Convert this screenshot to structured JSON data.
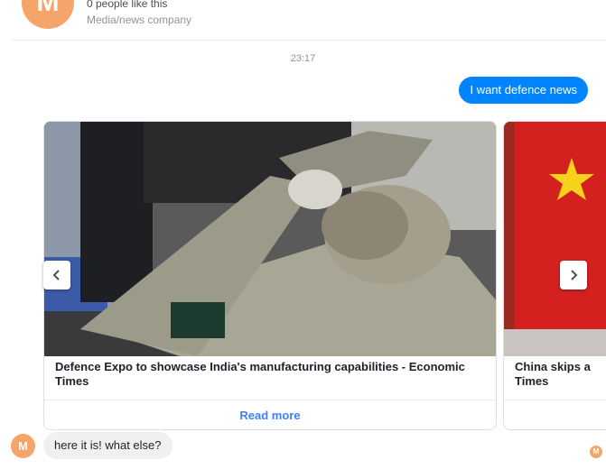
{
  "page": {
    "avatar_letter": "M",
    "likes_text": "0 people like this",
    "category": "Media/news company"
  },
  "conversation": {
    "timestamp": "23:17",
    "user_message": "I want defence news",
    "bot_message": "here it is! what else?",
    "read_receipt_letter": "M"
  },
  "carousel": {
    "cards": [
      {
        "title": "Defence Expo to showcase India's manufacturing capabilities - Economic Times",
        "button_label": "Read more",
        "image": "drone-model-photo"
      },
      {
        "title": "China skips a\nTimes",
        "button_label": "",
        "image": "china-flag-photo"
      }
    ],
    "prev_icon": "chevron-left-icon",
    "next_icon": "chevron-right-icon"
  },
  "colors": {
    "accent_blue": "#0084ff",
    "link_blue": "#4080ff",
    "avatar_orange": "#f5a56a",
    "bot_bubble": "#f1f0f0"
  }
}
